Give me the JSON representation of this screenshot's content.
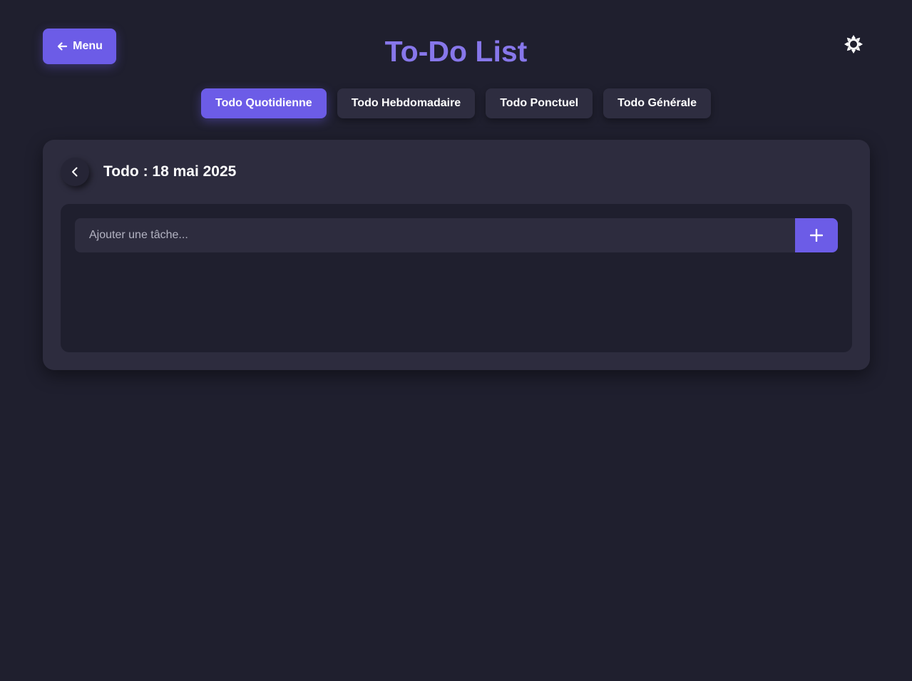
{
  "header": {
    "menu_label": "Menu",
    "title": "To-Do List",
    "theme_icon": "sun-icon"
  },
  "tabs": [
    {
      "label": "Todo Quotidienne",
      "active": true
    },
    {
      "label": "Todo Hebdomadaire",
      "active": false
    },
    {
      "label": "Todo Ponctuel",
      "active": false
    },
    {
      "label": "Todo Générale",
      "active": false
    }
  ],
  "card": {
    "title": "Todo : 18 mai 2025",
    "input_placeholder": "Ajouter une tâche...",
    "input_value": "",
    "add_icon": "plus-icon"
  },
  "colors": {
    "background": "#1f1f2e",
    "surface": "#2d2c3e",
    "accent": "#6c5ce7",
    "title": "#8777ea"
  }
}
